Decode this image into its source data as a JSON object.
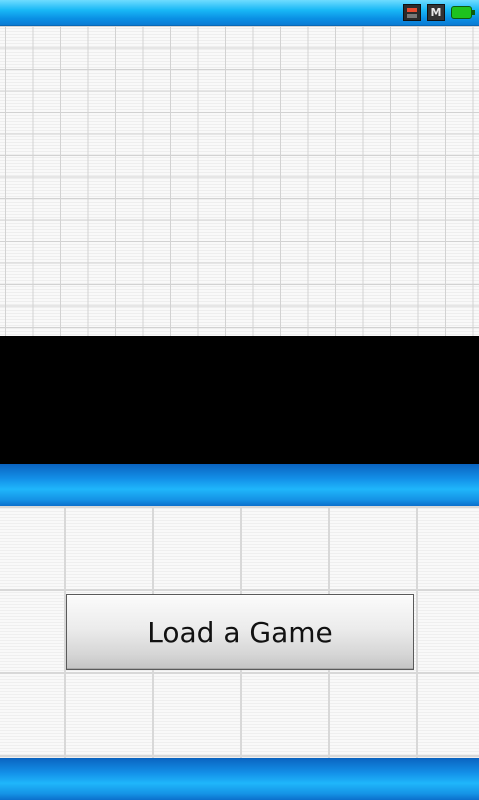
{
  "status_bar": {
    "icons": [
      "sd-card-icon",
      "m-icon",
      "battery-icon"
    ],
    "m_icon_text": "M",
    "battery_color": "#1ec21e"
  },
  "main": {
    "load_button_label": "Load a Game"
  },
  "colors": {
    "accent_blue": "#1fb6fb",
    "black_panel": "#000000",
    "grid_background": "#f7f7f7"
  }
}
